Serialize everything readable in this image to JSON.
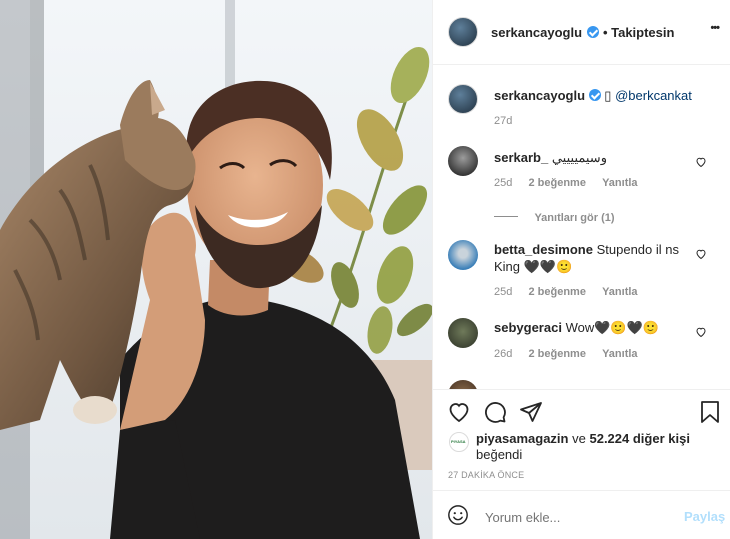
{
  "header": {
    "username": "serkancayoglu",
    "follow_state": "• Takiptesin",
    "more_label": "•••"
  },
  "caption": {
    "username": "serkancayoglu",
    "emoji": "▯",
    "mention": "@berkcankat",
    "time": "27d"
  },
  "comments": [
    {
      "username": "serkarb_",
      "text": "وسيمييييي",
      "time": "25d",
      "likes": "2 beğenme",
      "reply": "Yanıtla",
      "view_replies": "Yanıtları gör (1)"
    },
    {
      "username": "betta_desimone",
      "text": "Stupendo il ns King 🖤🖤🙂",
      "time": "25d",
      "likes": "2 beğenme",
      "reply": "Yanıtla"
    },
    {
      "username": "sebygeraci",
      "text": "Wow🖤🙂🖤🙂",
      "time": "26d",
      "likes": "2 beğenme",
      "reply": "Yanıtla"
    }
  ],
  "likes": {
    "liker": "piyasamagazin",
    "connector": "ve",
    "count": "52.224 diğer kişi",
    "suffix": "beğendi",
    "liker_avatar_text": "PIYASA"
  },
  "timestamp": "27 DAKİKA ÖNCE",
  "composer": {
    "placeholder": "Yorum ekle...",
    "post_label": "Paylaş"
  },
  "colors": {
    "verified": "#3897f0",
    "link": "#00376b",
    "post_disabled": "#b2dffc"
  }
}
